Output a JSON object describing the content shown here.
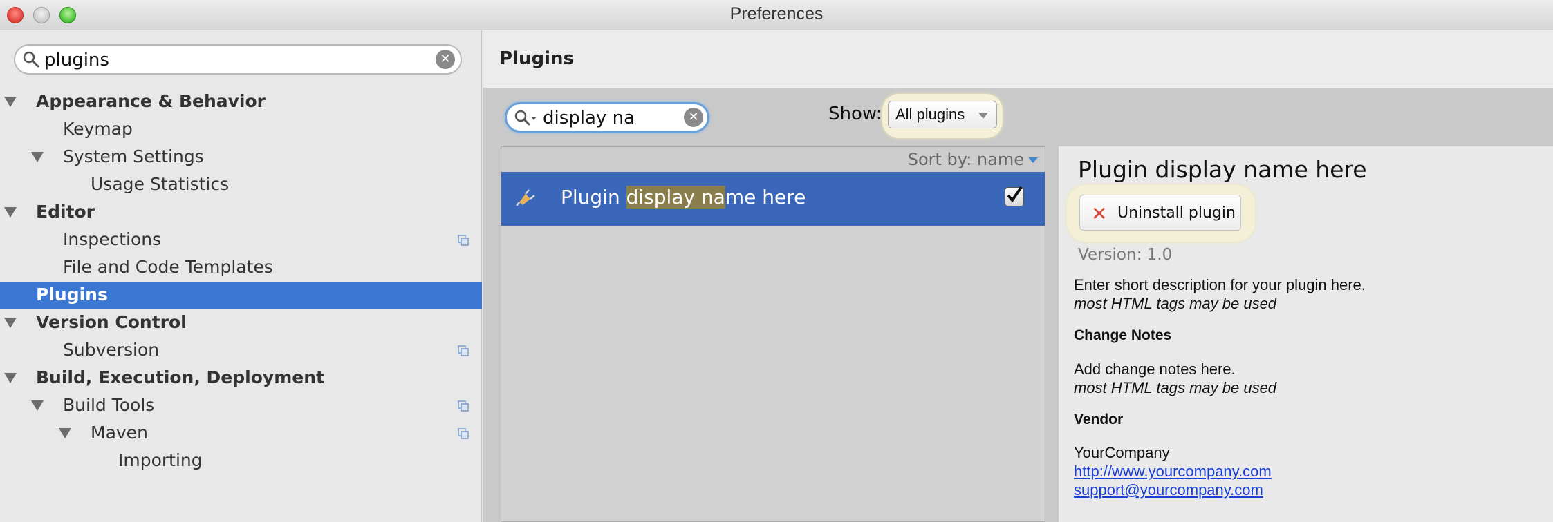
{
  "window": {
    "title": "Preferences"
  },
  "sidebar": {
    "search": {
      "value": "plugins"
    },
    "items": [
      {
        "label": "Appearance & Behavior"
      },
      {
        "label": "Keymap"
      },
      {
        "label": "System Settings"
      },
      {
        "label": "Usage Statistics"
      },
      {
        "label": "Editor"
      },
      {
        "label": "Inspections"
      },
      {
        "label": "File and Code Templates"
      },
      {
        "label": "Plugins"
      },
      {
        "label": "Version Control"
      },
      {
        "label": "Subversion"
      },
      {
        "label": "Build, Execution, Deployment"
      },
      {
        "label": "Build Tools"
      },
      {
        "label": "Maven"
      },
      {
        "label": "Importing"
      }
    ],
    "selected": "Plugins"
  },
  "main": {
    "title": "Plugins",
    "search": {
      "value": "display na"
    },
    "show": {
      "label": "Show:",
      "selected": "All plugins"
    },
    "list": {
      "sort_label": "Sort by: name",
      "plugins": [
        {
          "name_prefix": "Plugin ",
          "name_match": "display na",
          "name_suffix": "me here",
          "enabled": true
        }
      ]
    },
    "detail": {
      "name": "Plugin display name here",
      "uninstall_label": "Uninstall plugin",
      "version": "Version: 1.0",
      "description_line1": "Enter short description for your plugin here.",
      "description_line2": "most HTML tags may be used",
      "change_notes_heading": "Change Notes",
      "change_notes_line1": "Add change notes here.",
      "change_notes_line2": "most HTML tags may be used",
      "vendor_heading": "Vendor",
      "vendor_name": "YourCompany",
      "vendor_url": "http://www.yourcompany.com",
      "vendor_email": "support@yourcompany.com"
    }
  },
  "colors": {
    "selection": "#3b78d4",
    "list_selection": "#3a67ba",
    "search_match": "#8a7d4c",
    "highlight_glow": "#f4f0d8",
    "link": "#1a3fd6",
    "uninstall_icon": "#d84a3a"
  }
}
